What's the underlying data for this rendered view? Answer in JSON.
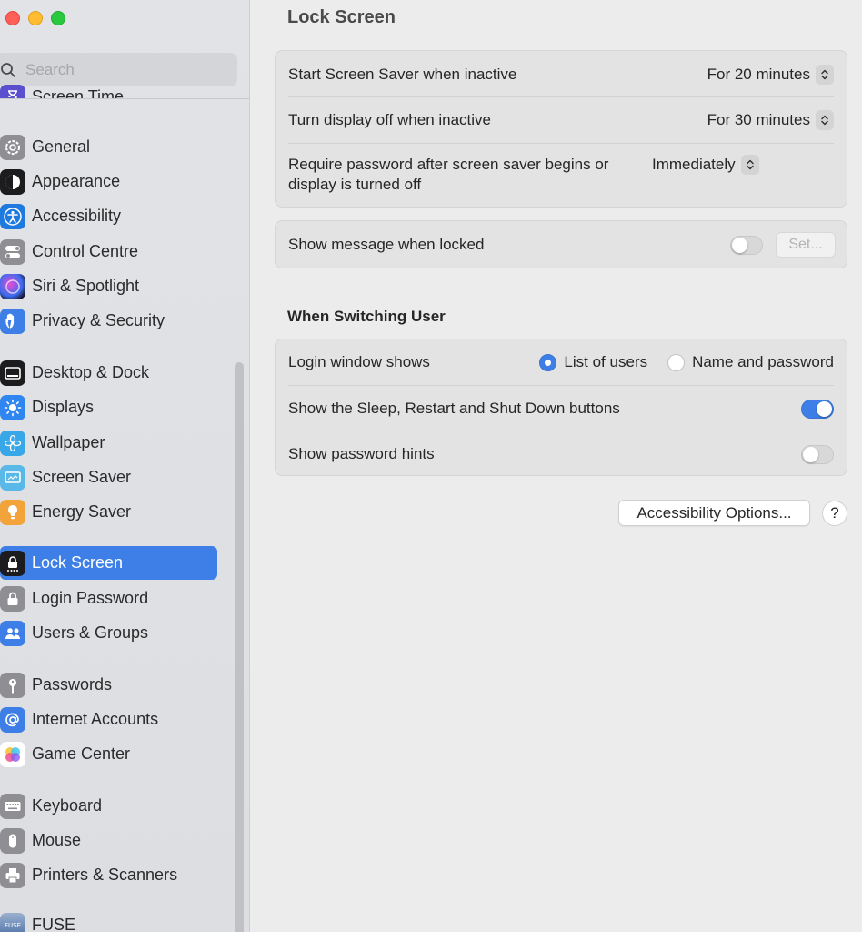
{
  "window": {
    "controls": [
      "close",
      "minimize",
      "zoom"
    ]
  },
  "sidebar": {
    "search_placeholder": "Search",
    "clipped_item": {
      "label": "Screen Time",
      "icon": "hourglass-icon",
      "color": "#5a4fcf"
    },
    "items": [
      {
        "label": "General",
        "icon": "gear-icon",
        "color": "#8e8e93"
      },
      {
        "label": "Appearance",
        "icon": "appearance-icon",
        "color": "#1c1c1e"
      },
      {
        "label": "Accessibility",
        "icon": "accessibility-icon",
        "color": "#1f7ae0"
      },
      {
        "label": "Control Centre",
        "icon": "control-centre-icon",
        "color": "#8e8e93"
      },
      {
        "label": "Siri & Spotlight",
        "icon": "siri-icon",
        "color": "#2b2b6b"
      },
      {
        "label": "Privacy & Security",
        "icon": "hand-icon",
        "color": "#3d7fe6"
      },
      {
        "label": "Desktop & Dock",
        "icon": "dock-icon",
        "color": "#1c1c1e"
      },
      {
        "label": "Displays",
        "icon": "sun-icon",
        "color": "#2f86f0"
      },
      {
        "label": "Wallpaper",
        "icon": "flower-icon",
        "color": "#38a7e8"
      },
      {
        "label": "Screen Saver",
        "icon": "screen-saver-icon",
        "color": "#5ab8e8"
      },
      {
        "label": "Energy Saver",
        "icon": "bulb-icon",
        "color": "#f2a33a"
      },
      {
        "label": "Lock Screen",
        "icon": "lock-screen-icon",
        "color": "#1c1c1e",
        "selected": true
      },
      {
        "label": "Login Password",
        "icon": "lock-icon",
        "color": "#8e8e93"
      },
      {
        "label": "Users & Groups",
        "icon": "users-icon",
        "color": "#3d7fe6"
      },
      {
        "label": "Passwords",
        "icon": "key-icon",
        "color": "#8e8e93"
      },
      {
        "label": "Internet Accounts",
        "icon": "at-icon",
        "color": "#3d7fe6"
      },
      {
        "label": "Game Center",
        "icon": "game-center-icon",
        "color": "#ffffff"
      },
      {
        "label": "Keyboard",
        "icon": "keyboard-icon",
        "color": "#8e8e93"
      },
      {
        "label": "Mouse",
        "icon": "mouse-icon",
        "color": "#8e8e93"
      },
      {
        "label": "Printers & Scanners",
        "icon": "printer-icon",
        "color": "#8e8e93"
      },
      {
        "label": "FUSE",
        "icon": "fuse-icon",
        "color": "#4a6fa5",
        "badge": "FUSE"
      }
    ]
  },
  "main": {
    "title": "Lock Screen",
    "settings": [
      {
        "label": "Start Screen Saver when inactive",
        "value": "For 20 minutes"
      },
      {
        "label": "Turn display off when inactive",
        "value": "For 30 minutes"
      },
      {
        "label": "Require password after screen saver begins or display is turned off",
        "value": "Immediately"
      }
    ],
    "message": {
      "label": "Show message when locked",
      "toggle_on": false,
      "set_button": "Set..."
    },
    "switching": {
      "title": "When Switching User",
      "login_label": "Login window shows",
      "options": [
        {
          "label": "List of users",
          "selected": true
        },
        {
          "label": "Name and password",
          "selected": false
        }
      ],
      "sleep_label": "Show the Sleep, Restart and Shut Down buttons",
      "sleep_on": true,
      "hints_label": "Show password hints",
      "hints_on": false
    },
    "accessibility_button": "Accessibility Options...",
    "help_button": "?"
  },
  "colors": {
    "accent": "#3d7fe6",
    "sidebar_bg": "#dfe1e4",
    "content_bg": "#ececec"
  }
}
